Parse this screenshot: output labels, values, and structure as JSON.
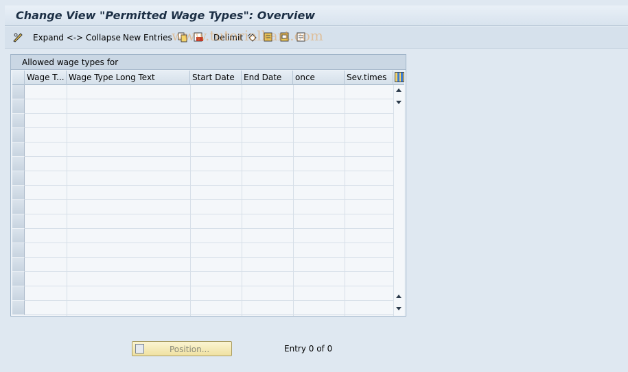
{
  "title": "Change View \"Permitted Wage Types\": Overview",
  "toolbar": {
    "expand_collapse_label": "Expand <-> Collapse",
    "new_entries_label": "New Entries",
    "delimit_label": "Delimit"
  },
  "watermark": "www.tutorialkart.com",
  "table": {
    "caption": "Allowed wage types for",
    "columns": [
      "Wage T...",
      "Wage Type Long Text",
      "Start Date",
      "End Date",
      "once",
      "Sev.times"
    ],
    "rows": []
  },
  "footer": {
    "position_label": "Position...",
    "entry_text": "Entry 0 of 0"
  },
  "colors": {
    "background": "#dfe8f1",
    "title_text": "#1c2f45",
    "button_bg": "#fbf4d2"
  }
}
